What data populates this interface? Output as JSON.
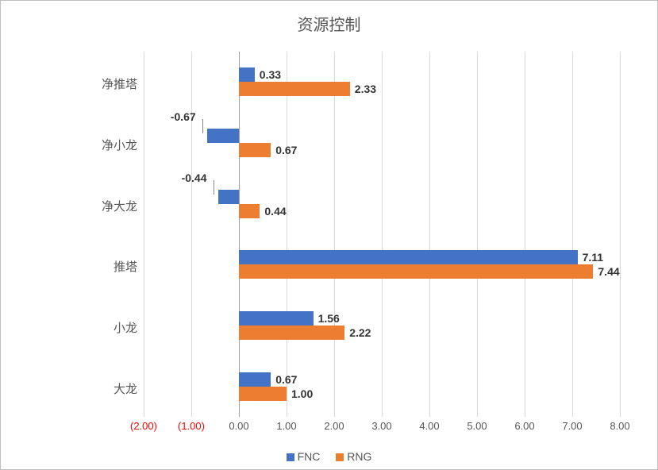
{
  "chart_data": {
    "type": "bar",
    "orientation": "horizontal",
    "title": "资源控制",
    "xlabel": "",
    "ylabel": "",
    "xlim": [
      -2.0,
      8.0
    ],
    "x_ticks": [
      -2.0,
      -1.0,
      0.0,
      1.0,
      2.0,
      3.0,
      4.0,
      5.0,
      6.0,
      7.0,
      8.0
    ],
    "x_tick_labels": [
      "(2.00)",
      "(1.00)",
      "0.00",
      "1.00",
      "2.00",
      "3.00",
      "4.00",
      "5.00",
      "6.00",
      "7.00",
      "8.00"
    ],
    "categories": [
      "大龙",
      "小龙",
      "推塔",
      "净大龙",
      "净小龙",
      "净推塔"
    ],
    "series": [
      {
        "name": "FNC",
        "color": "#4472c4",
        "values": [
          0.67,
          1.56,
          7.11,
          -0.44,
          -0.67,
          0.33
        ]
      },
      {
        "name": "RNG",
        "color": "#ed7d31",
        "values": [
          1.0,
          2.22,
          7.44,
          0.44,
          0.67,
          2.33
        ]
      }
    ],
    "legend_position": "bottom",
    "grid": true
  },
  "legend": {
    "fnc": "FNC",
    "rng": "RNG"
  }
}
